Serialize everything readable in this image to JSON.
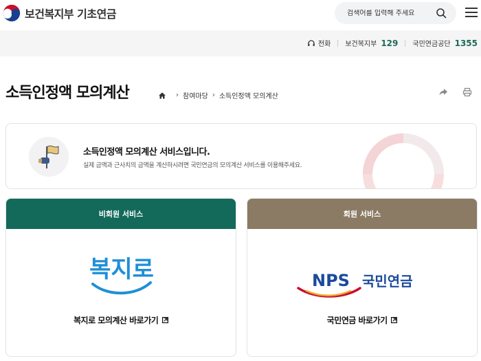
{
  "header": {
    "logo_text": "보건복지부 기초연금",
    "search_placeholder": "검색어를 입력해 주세요"
  },
  "util": {
    "phone_label": "전화",
    "contacts": [
      {
        "name": "보건복지부",
        "number": "129"
      },
      {
        "name": "국민연금공단",
        "number": "1355"
      }
    ]
  },
  "page": {
    "title": "소득인정액 모의계산",
    "breadcrumb": [
      "참여마당",
      "소득인정액 모의계산"
    ]
  },
  "info": {
    "title": "소득인정액 모의계산 서비스입니다.",
    "desc": "실제 금액과 근사치의 금액을 계산하시려면 국민연금의 모의계산 서비스를 이용해주세요."
  },
  "cards": {
    "left": {
      "header": "비회원 서비스",
      "link": "복지로 모의계산 바로가기"
    },
    "right": {
      "header": "회원 서비스",
      "link": "국민연금 바로가기"
    }
  },
  "logos": {
    "bokjiro": "복지로",
    "nps_en": "NPS",
    "nps_ko": "국민연금"
  },
  "colors": {
    "green": "#13695a",
    "brown": "#8b7a64",
    "nps_blue": "#1a4a9c",
    "bokjiro_blue": "#1e8fd8"
  }
}
